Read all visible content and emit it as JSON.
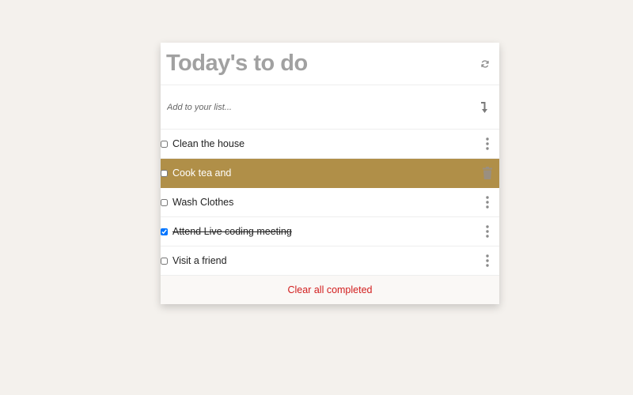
{
  "header": {
    "title": "Today's to do",
    "refresh_icon": "refresh-icon"
  },
  "add": {
    "placeholder": "Add to your list...",
    "value": "",
    "enter_icon": "enter-arrow-icon"
  },
  "todos": [
    {
      "label": "Clean the house",
      "checked": false,
      "highlighted": false,
      "action_icon": "kebab-menu-icon"
    },
    {
      "label": "Cook tea and",
      "checked": false,
      "highlighted": true,
      "action_icon": "trash-icon"
    },
    {
      "label": "Wash Clothes",
      "checked": false,
      "highlighted": false,
      "action_icon": "kebab-menu-icon"
    },
    {
      "label": "Attend Live coding meeting",
      "checked": true,
      "highlighted": false,
      "action_icon": "kebab-menu-icon"
    },
    {
      "label": "Visit a friend",
      "checked": false,
      "highlighted": false,
      "action_icon": "kebab-menu-icon"
    }
  ],
  "footer": {
    "clear_label": "Clear all completed"
  },
  "colors": {
    "background": "#f4f1ed",
    "highlight": "#b08f48",
    "clear_text": "#d21d1d",
    "title": "#a1a1a1"
  }
}
